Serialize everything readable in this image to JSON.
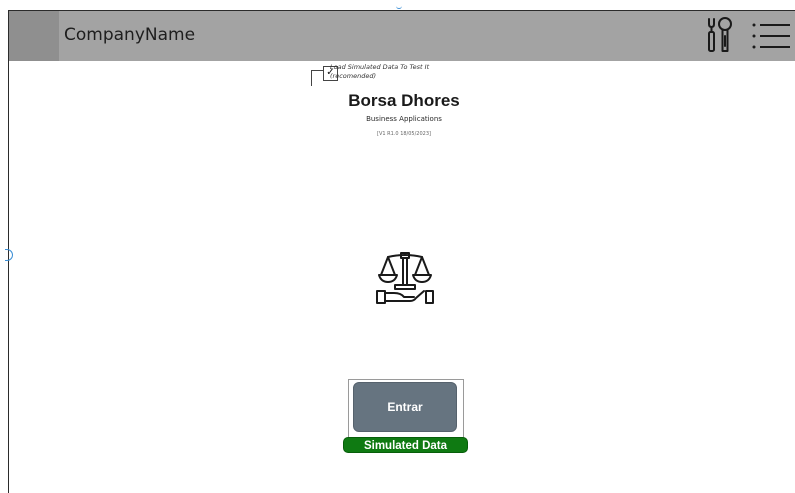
{
  "header": {
    "company_name": "CompanyName",
    "background": "#a3a3a3"
  },
  "options": {
    "simulated_label_line1": "Load Simulated Data To Test It",
    "simulated_label_line2": "(recomended)",
    "simulated_checked": true
  },
  "app": {
    "title": "Borsa Dhores",
    "subtitle": "Business Applications",
    "version": "[V1 R1.0 18/05/2023]"
  },
  "actions": {
    "enter_label": "Entrar",
    "enter_color": "#667480"
  },
  "status": {
    "badge_label": "Simulated Data",
    "badge_color": "#0f7a12"
  },
  "icons": {
    "header_tools": "tools-icon",
    "header_menu": "menu-icon",
    "logo": "justice-scales-icon"
  }
}
